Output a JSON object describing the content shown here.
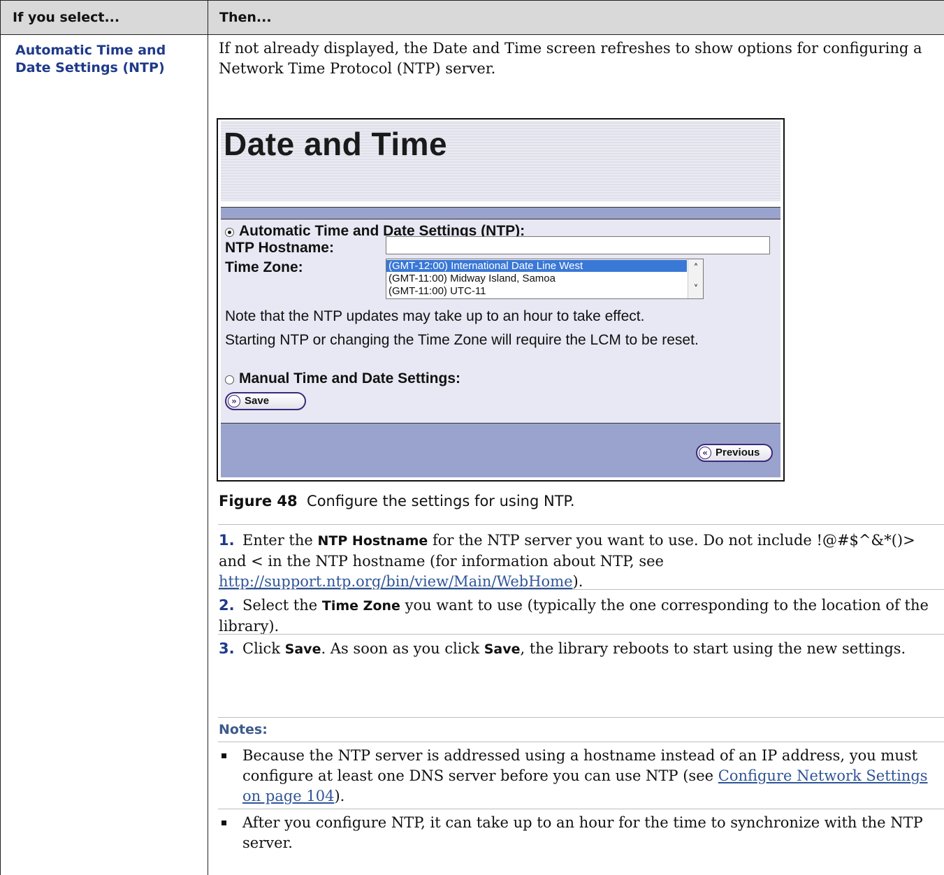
{
  "table": {
    "header_col1": "If you select...",
    "header_col2": "Then...",
    "row_label": "Automatic Time and Date Settings (NTP)",
    "intro": "If not already displayed, the Date and Time screen refreshes to show options for configuring a Network Time Protocol (NTP) server."
  },
  "screen": {
    "title": "Date and Time",
    "auto_radio_label": "Automatic Time and Date Settings (NTP):",
    "auto_selected": true,
    "hostname_label": "NTP Hostname:",
    "hostname_value": "",
    "timezone_label": "Time Zone:",
    "timezone_options": [
      "(GMT-12:00) International Date Line West",
      "(GMT-11:00) Midway Island, Samoa",
      "(GMT-11:00) UTC-11"
    ],
    "timezone_selected": "(GMT-12:00) International Date Line West",
    "note1": "Note that the NTP updates may take up to an hour to take effect.",
    "note2": "Starting NTP or changing the Time Zone will require the LCM to be reset.",
    "manual_radio_label": "Manual Time and Date Settings:",
    "save_button": "Save",
    "previous_button": "Previous"
  },
  "figure": {
    "number": "Figure 48",
    "caption": "Configure the settings for using NTP."
  },
  "steps": [
    {
      "num": "1.",
      "pre": "Enter the ",
      "bold": "NTP Hostname",
      "post": " for the NTP server you want to use. Do not include !@#$^&*()> and <  in the NTP hostname (for information about NTP, see ",
      "link": "http://support.ntp.org/bin/view/Main/WebHome",
      "tail": ")."
    },
    {
      "num": "2.",
      "pre": "Select the ",
      "bold": "Time Zone",
      "post": " you want to use (typically the one corresponding to the location of the library)."
    },
    {
      "num": "3.",
      "pre": "Click ",
      "bold": "Save",
      "mid": ". As soon as you click ",
      "bold2": "Save",
      "post": ", the library reboots to start using the new settings."
    }
  ],
  "notes": {
    "heading": "Notes:",
    "items": [
      {
        "pre": "Because the NTP server is addressed using a hostname instead of an IP address, you must configure at least one DNS server before you can use NTP (see ",
        "link": "Configure Network Settings on page 104",
        "post": ")."
      },
      {
        "pre": "After you configure NTP, it can take up to an hour for the time to synchronize with the NTP server."
      }
    ]
  }
}
